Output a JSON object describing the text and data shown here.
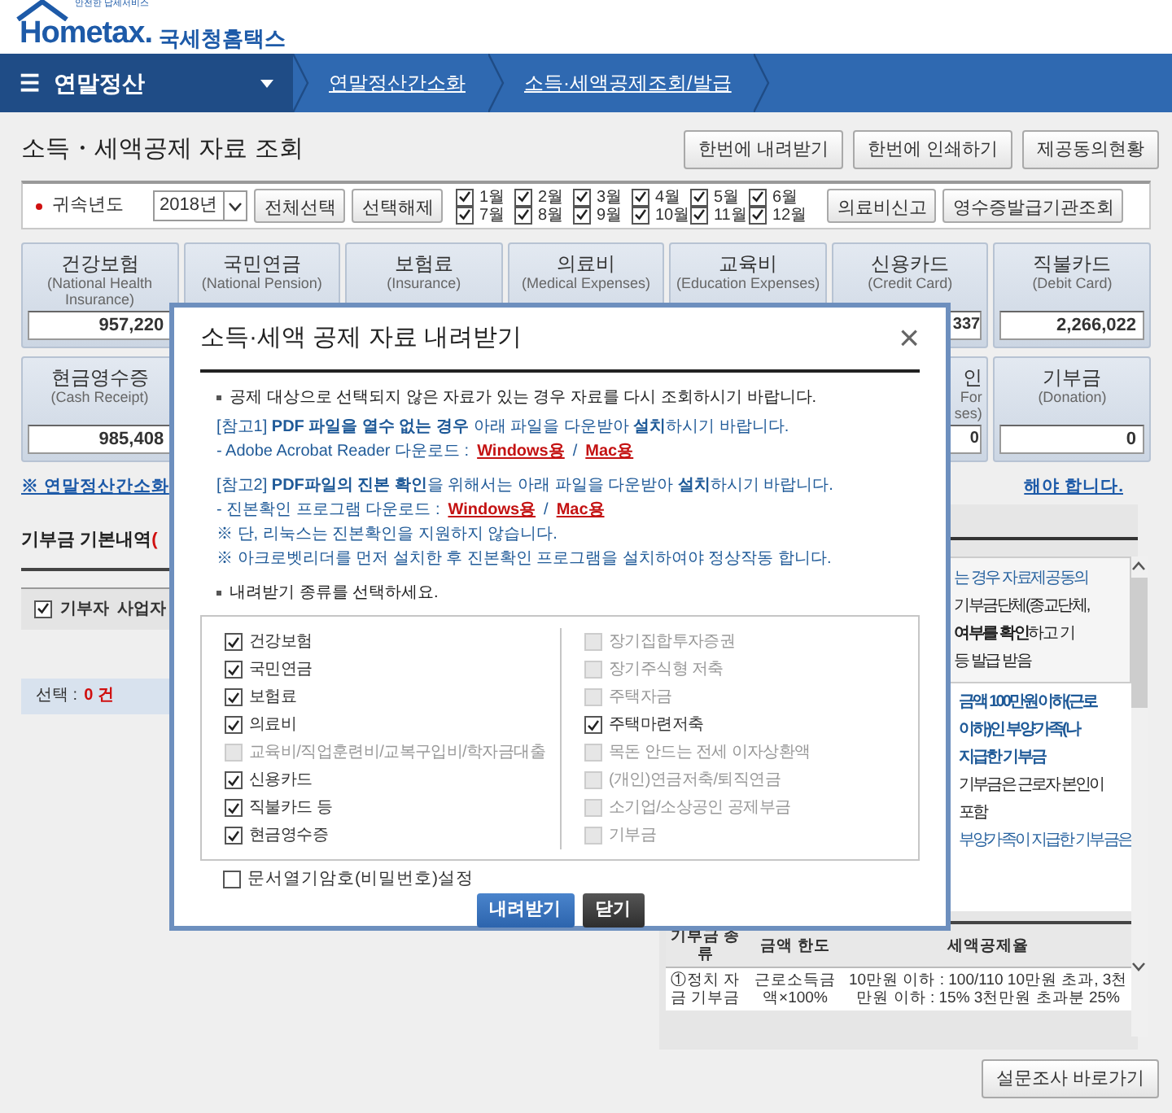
{
  "header": {
    "brand": "Hometax.",
    "tagline": "안전한 납세서비스",
    "org": "국세청홈택스"
  },
  "nav": {
    "menu_icon": "☰",
    "menu": "연말정산",
    "breadcrumbs": [
      "연말정산간소화",
      "소득·세액공제조회/발급"
    ]
  },
  "page_title": "소득・세액공제 자료 조회",
  "top_buttons": [
    "한번에 내려받기",
    "한번에 인쇄하기",
    "제공동의현황"
  ],
  "filter": {
    "label": "귀속년도",
    "year": "2018년",
    "buttons": [
      "전체선택",
      "선택해제"
    ],
    "months": [
      {
        "label": "1월",
        "checked": true
      },
      {
        "label": "2월",
        "checked": true
      },
      {
        "label": "3월",
        "checked": true
      },
      {
        "label": "4월",
        "checked": true
      },
      {
        "label": "5월",
        "checked": true
      },
      {
        "label": "6월",
        "checked": true
      },
      {
        "label": "7월",
        "checked": true
      },
      {
        "label": "8월",
        "checked": true
      },
      {
        "label": "9월",
        "checked": true
      },
      {
        "label": "10월",
        "checked": true
      },
      {
        "label": "11월",
        "checked": true
      },
      {
        "label": "12월",
        "checked": true
      }
    ],
    "right_buttons": [
      "의료비신고",
      "영수증발급기관조회"
    ]
  },
  "card_rows": [
    [
      {
        "kind": "full",
        "title": "건강보험",
        "subtitle": "(National Health Insurance)",
        "value": "957,220"
      },
      {
        "kind": "title_only",
        "title": "국민연금",
        "subtitle": "(National Pension)"
      },
      {
        "kind": "title_only",
        "title": "보험료",
        "subtitle": "(Insurance)"
      },
      {
        "kind": "title_only",
        "title": "의료비",
        "subtitle": "(Medical Expenses)"
      },
      {
        "kind": "title_only",
        "title": "교육비",
        "subtitle": "(Education Expenses)"
      },
      {
        "kind": "value_cut",
        "title": "신용카드",
        "subtitle": "(Credit Card)",
        "value": "337"
      },
      {
        "kind": "full",
        "title": "직불카드",
        "subtitle": "(Debit Card)",
        "value": "2,266,022"
      }
    ],
    [
      {
        "kind": "full",
        "title": "현금영수증",
        "subtitle": "(Cash Receipt)",
        "value": "985,408"
      },
      {
        "kind": "cut",
        "title": "인",
        "subtitle": "For ses)",
        "value": "0"
      },
      {
        "kind": "full",
        "title": "기부금",
        "subtitle": "(Donation)",
        "value": "0"
      }
    ]
  ],
  "notice": {
    "left": "※ 연말정산간소화",
    "right": "해야 합니다."
  },
  "donation": {
    "title": "기부금 기본내역",
    "title_note": "(",
    "header_checked": true,
    "columns": [
      "기부자",
      "사업자"
    ],
    "summary_label": "선택 :",
    "summary_count": "0 건"
  },
  "info_panel": {
    "lines": [
      {
        "kind": "note",
        "text": "는 경우 자료제공동의"
      },
      {
        "kind": "plain",
        "text": "기부금단체(종교단체,"
      },
      {
        "kind": "plain",
        "text": "**여부를 확인**하고 기"
      },
      {
        "kind": "plain",
        "text": "등 발급 받음"
      },
      {
        "kind": "emphasis",
        "text": "금액 100만원이하(근로"
      },
      {
        "kind": "emphasis",
        "text": "이하)인 부양가족(나"
      },
      {
        "kind": "emphasis",
        "text": "지급한 기부금"
      },
      {
        "kind": "plain",
        "text": "기부금은 근로자 본인이"
      },
      {
        "kind": "plain",
        "text": "포함"
      },
      {
        "kind": "note",
        "text": "부양가족이 지급한 기부금은"
      }
    ],
    "table_columns": [
      "기부금 종류",
      "금액 한도",
      "세액공제율"
    ],
    "table_row": [
      "①정치 자금 기부금",
      "근로소득금액×100%",
      "10만원 이하 : 100/110 10만원 초과, 3천만원 이하 : 15% 3천만원 초과분 25%"
    ]
  },
  "survey_button": "설문조사 바로가기",
  "modal": {
    "title": "소득·세액 공제 자료 내려받기",
    "close": "×",
    "notes": [
      {
        "kind": "bullet",
        "text": "공제 대상으로 선택되지 않은 자료가 있는 경우 자료를 다시 조회하시기 바랍니다."
      },
      {
        "kind": "ref",
        "text": "[참고1] **PDF 파일을 열수 없는 경우** 아래 파일을 다운받아 **설치**하시기 바랍니다."
      },
      {
        "kind": "download",
        "text": "- Adobe Acrobat Reader 다운로드 :",
        "links": [
          "Windows용",
          "Mac용"
        ],
        "separator": "/"
      },
      {
        "kind": "ref",
        "text": "[참고2] **PDF파일의 진본 확인**을 위해서는 아래 파일을 다운받아 **설치**하시기 바랍니다."
      },
      {
        "kind": "download",
        "text": "- 진본확인 프로그램 다운로드 :",
        "links": [
          "Windows용",
          "Mac용"
        ],
        "separator": "/"
      },
      {
        "kind": "ref",
        "text": "※ 단, 리눅스는 진본확인을 지원하지 않습니다."
      },
      {
        "kind": "ref",
        "text": "※ 아크로벳리더를 먼저 설치한 후 진본확인 프로그램을 설치하여야 정상작동 합니다."
      },
      {
        "kind": "bullet",
        "text": "내려받기 종류를 선택하세요."
      }
    ],
    "options": [
      [
        {
          "label": "건강보험",
          "checked": true,
          "disabled": false
        },
        {
          "label": "국민연금",
          "checked": true,
          "disabled": false
        },
        {
          "label": "보험료",
          "checked": true,
          "disabled": false
        },
        {
          "label": "의료비",
          "checked": true,
          "disabled": false
        },
        {
          "label": "교육비/직업훈련비/교복구입비/학자금대출",
          "checked": false,
          "disabled": true
        },
        {
          "label": "신용카드",
          "checked": true,
          "disabled": false
        },
        {
          "label": "직불카드 등",
          "checked": true,
          "disabled": false
        },
        {
          "label": "현금영수증",
          "checked": true,
          "disabled": false
        }
      ],
      [
        {
          "label": "장기집합투자증권",
          "checked": false,
          "disabled": true
        },
        {
          "label": "장기주식형 저축",
          "checked": false,
          "disabled": true
        },
        {
          "label": "주택자금",
          "checked": false,
          "disabled": true
        },
        {
          "label": "주택마련저축",
          "checked": true,
          "disabled": false
        },
        {
          "label": "목돈 안드는 전세 이자상환액",
          "checked": false,
          "disabled": true
        },
        {
          "label": "(개인)연금저축/퇴직연금",
          "checked": false,
          "disabled": true
        },
        {
          "label": "소기업/소상공인 공제부금",
          "checked": false,
          "disabled": true
        },
        {
          "label": "기부금",
          "checked": false,
          "disabled": true
        }
      ]
    ],
    "password": {
      "label": "문서열기암호(비밀번호)설정",
      "checked": false
    },
    "buttons": [
      {
        "kind": "primary",
        "label": "내려받기"
      },
      {
        "kind": "dark",
        "label": "닫기"
      }
    ]
  }
}
